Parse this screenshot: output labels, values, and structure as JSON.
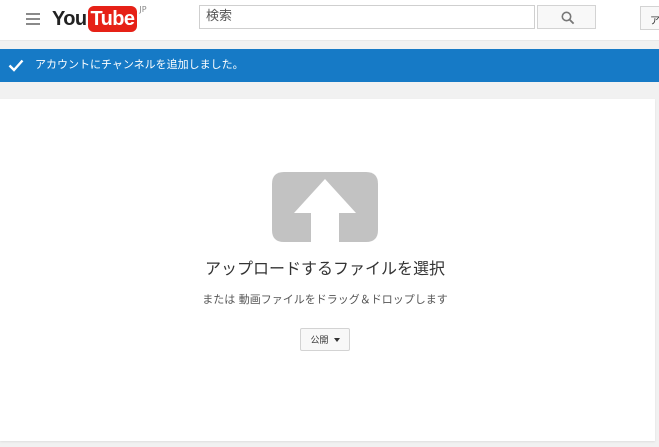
{
  "header": {
    "logo_you": "You",
    "logo_tube": "Tube",
    "logo_region": "JP",
    "search_placeholder": "検索",
    "account_label": "ア"
  },
  "notice": {
    "text": "アカウントにチャンネルを追加しました。"
  },
  "upload": {
    "title": "アップロードするファイルを選択",
    "subtitle": "または 動画ファイルをドラッグ＆ドロップします",
    "privacy_value": "公開"
  },
  "colors": {
    "brand_red": "#e62117",
    "notice_blue": "#167ac6",
    "upload_icon_gray": "#c2c2c2"
  },
  "icons": [
    "menu-icon",
    "search-icon",
    "check-icon",
    "upload-icon",
    "chevron-down-icon"
  ]
}
